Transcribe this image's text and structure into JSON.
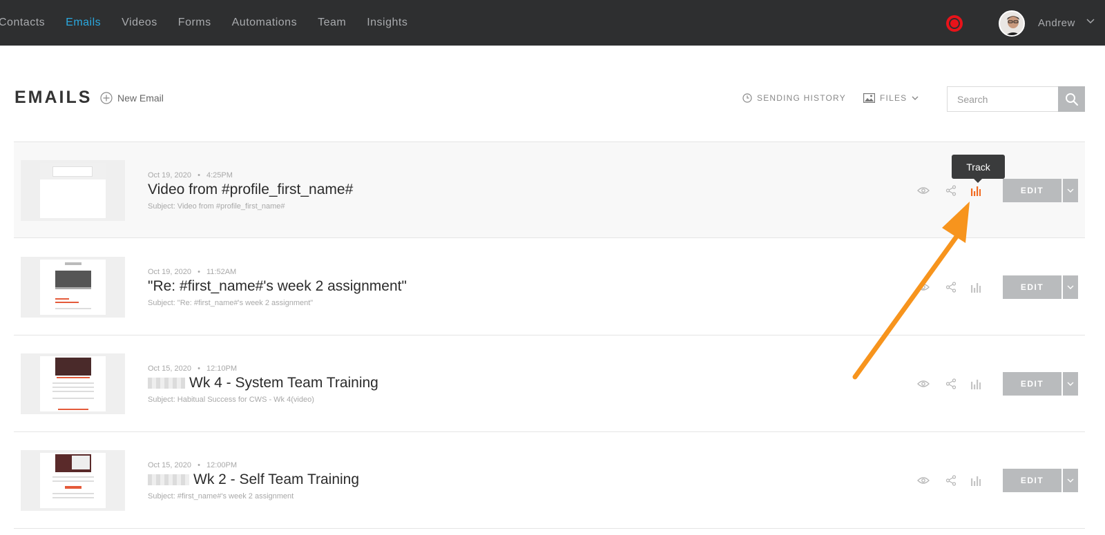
{
  "nav": {
    "items": [
      "Contacts",
      "Emails",
      "Videos",
      "Forms",
      "Automations",
      "Team",
      "Insights"
    ],
    "active_index": 1
  },
  "user": {
    "name": "Andrew"
  },
  "header": {
    "title": "EMAILS",
    "new_email_label": "New Email",
    "sending_history_label": "SENDING HISTORY",
    "files_label": "FILES",
    "search_placeholder": "Search"
  },
  "tooltip": {
    "track": "Track"
  },
  "emails": [
    {
      "date": "Oct 19, 2020",
      "time": "4:25PM",
      "title": "Video from #profile_first_name#",
      "subject": "Subject: Video from #profile_first_name#",
      "edit_label": "EDIT"
    },
    {
      "date": "Oct 19, 2020",
      "time": "11:52AM",
      "title": "\"Re: #first_name#'s week 2 assignment\"",
      "subject": "Subject: \"Re: #first_name#'s week 2 assignment\"",
      "edit_label": "EDIT"
    },
    {
      "date": "Oct 15, 2020",
      "time": "12:10PM",
      "title": "Wk 4 - System Team Training",
      "subject": "Subject: Habitual Success for CWS - Wk 4(video)",
      "edit_label": "EDIT"
    },
    {
      "date": "Oct 15, 2020",
      "time": "12:00PM",
      "title": "Wk 2 - Self Team Training",
      "subject": "Subject: #first_name#'s week 2 assignment",
      "edit_label": "EDIT"
    }
  ],
  "colors": {
    "nav_bg": "#2e2f30",
    "nav_active": "#2aa9e0",
    "record": "#e8131a",
    "track_active": "#f26b21",
    "annotation_arrow": "#f7941d",
    "button_gray": "#b9bbbd"
  },
  "icons": {
    "new_email": "plus-circle-icon",
    "sending_history": "clock-icon",
    "files": "image-icon",
    "search": "search-icon",
    "preview": "eye-icon",
    "share": "share-icon",
    "track": "bar-chart-icon",
    "dropdown": "chevron-down-icon"
  }
}
